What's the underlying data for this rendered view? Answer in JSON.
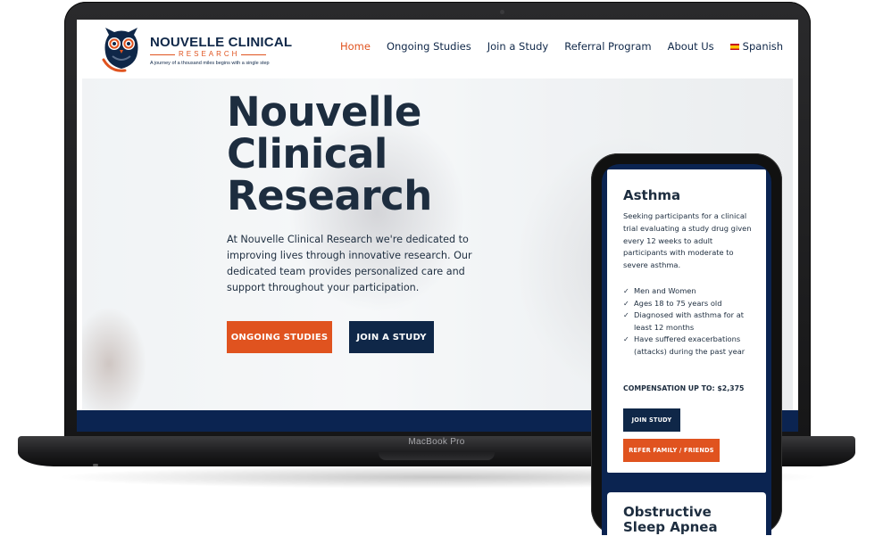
{
  "device": {
    "laptop_label": "MacBook Pro"
  },
  "site": {
    "logo": {
      "title": "NOUVELLE CLINICAL",
      "subtitle": "RESEARCH",
      "tagline": "A journey of a thousand miles begins with a single step"
    },
    "nav": {
      "items": [
        {
          "label": "Home",
          "active": true
        },
        {
          "label": "Ongoing Studies",
          "active": false
        },
        {
          "label": "Join a Study",
          "active": false
        },
        {
          "label": "Referral Program",
          "active": false
        },
        {
          "label": "About Us",
          "active": false
        }
      ],
      "language": {
        "label": "Spanish",
        "flag_icon": "spain-flag-icon"
      }
    },
    "hero": {
      "title": "Nouvelle Clinical Research",
      "text": "At Nouvelle Clinical Research we're dedicated to improving lives through innovative research. Our dedicated team provides personalized care and support throughout your participation.",
      "btn_ongoing": "ONGOING STUDIES",
      "btn_join": "JOIN A STUDY"
    }
  },
  "mobile": {
    "card1": {
      "title": "Asthma",
      "description": "Seeking participants for a clinical trial evaluating a study drug given every 12 weeks to adult participants with moderate to severe asthma.",
      "criteria": [
        "Men and Women",
        "Ages 18 to 75 years old",
        "Diagnosed with asthma for at least 12 months",
        "Have suffered exacerbations (attacks) during the past year"
      ],
      "compensation": "COMPENSATION UP TO: $2,375",
      "btn_join": "JOIN STUDY",
      "btn_refer": "REFER FAMILY / FRIENDS"
    },
    "card2": {
      "title": "Obstructive Sleep Apnea"
    }
  },
  "colors": {
    "navy": "#0f2748",
    "orange": "#e0531f",
    "band": "#0b2451"
  }
}
